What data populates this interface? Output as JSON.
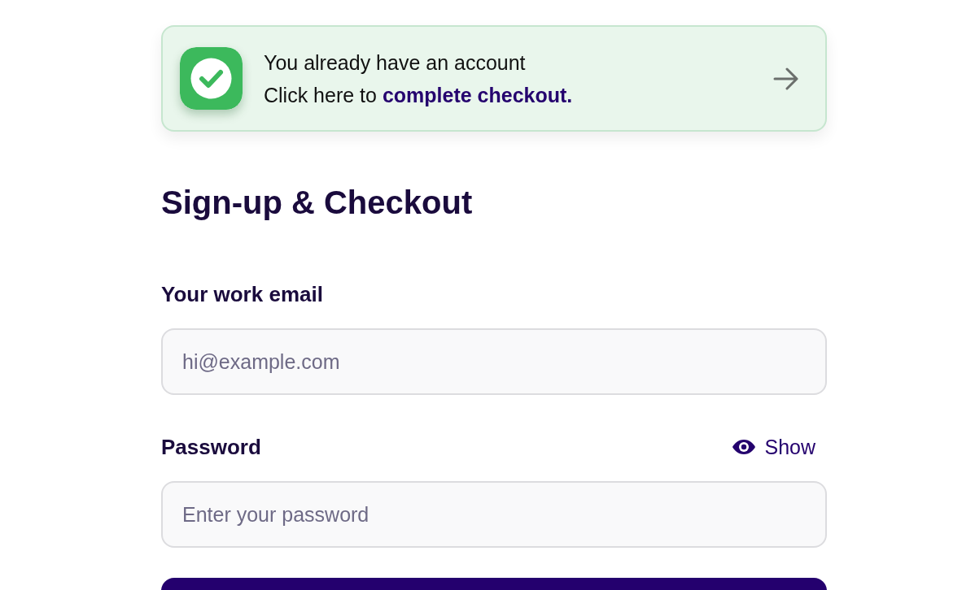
{
  "notice": {
    "title": "You already have an account",
    "message": "Click here to",
    "link": "complete checkout."
  },
  "heading": "Sign-up & Checkout",
  "fields": [
    {
      "kind": "email",
      "label": "Your work email",
      "placeholder": "hi@example.com"
    },
    {
      "kind": "password",
      "label": "Password",
      "placeholder": "Enter your password",
      "toggle": "Show"
    }
  ]
}
